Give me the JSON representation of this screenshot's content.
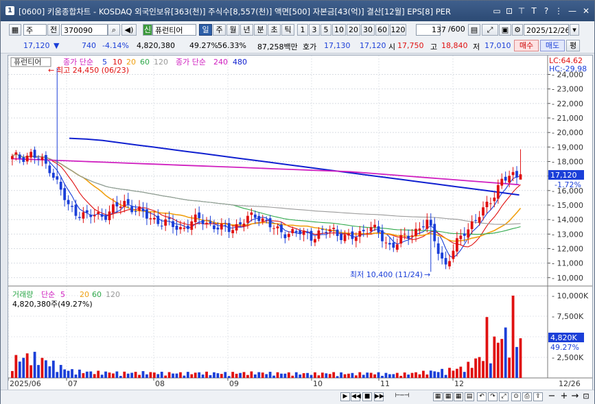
{
  "window": {
    "number": "1",
    "title": "[0600] 키움종합차트 - KOSDAQ 외국인보유[363(천)] 주식수[8,557(천)] 액면[500] 자본금[43(억)] 결산[12월] EPS[8] PER"
  },
  "toolbar": {
    "period_type": "주",
    "prev_label": "전",
    "code": "370090",
    "credit_badge": "신",
    "stock_name": "퓨런티어",
    "tabs": [
      "일",
      "주",
      "월",
      "년",
      "분",
      "초",
      "틱"
    ],
    "active_tab": "일",
    "intervals": [
      "1",
      "3",
      "5",
      "10",
      "20",
      "30",
      "60",
      "120"
    ],
    "count": "137",
    "count_total": "/600",
    "date": "2025/12/26"
  },
  "quote": {
    "price": "17,120",
    "change": "740",
    "change_pct": "-4.14%",
    "volume": "4,820,380",
    "vol_ratio1": "49.27%",
    "vol_ratio2": "56.33%",
    "amount": "87,258백만",
    "ask_label": "호가",
    "ask": "17,130",
    "bid": "17,120",
    "open_label": "시",
    "open": "17,750",
    "high_label": "고",
    "high": "18,840",
    "low_label": "저",
    "low": "17,010",
    "buy_btn": "매수",
    "sell_btn": "매도",
    "eval_btn": "평"
  },
  "price_panel": {
    "legend_name": "퓨런티어",
    "legend_ma_label": "종가 단순",
    "legend_ma_periods": [
      "5",
      "10",
      "20",
      "60",
      "120"
    ],
    "legend_ma2_label": "종가 단순",
    "legend_ma2_periods": [
      "240",
      "480"
    ],
    "lc_label": "LC:64.62",
    "hc_label": "HC:-29.98",
    "high_annotation": "최고 24,450 (06/23)",
    "low_annotation": "최저 10,400 (11/24)",
    "current_price_tag": "17,120",
    "current_change_tag": "-1.72%",
    "y_ticks": [
      "24,000",
      "23,000",
      "22,000",
      "21,000",
      "20,000",
      "19,000",
      "18,000",
      "17,000",
      "16,000",
      "15,000",
      "14,000",
      "13,000",
      "12,000",
      "11,000",
      "10,000"
    ],
    "colors": {
      "up": "#e01010",
      "down": "#1b3fd8",
      "ma5": "#1b3fd8",
      "ma10": "#e01010",
      "ma20": "#f0a010",
      "ma60": "#2ea84a",
      "ma120": "#9a9a9a",
      "ma240": "#d020c0",
      "ma480": "#1020d0"
    }
  },
  "volume_panel": {
    "legend_name": "거래량",
    "legend_ma_label": "단순",
    "legend_ma_periods": [
      "5",
      "20",
      "60",
      "120"
    ],
    "volume_text": "4,820,380주(49.27%)",
    "y_ticks": [
      "10,000K",
      "7,500K",
      "5,000K",
      "2,500K"
    ],
    "current_tag": "4,820K",
    "current_pct": "49.27%"
  },
  "x_axis": {
    "labels": [
      "2025/06",
      "07",
      "08",
      "09",
      "10",
      "11",
      "12"
    ],
    "right_label": "12/26"
  },
  "chart_data": {
    "type": "candlestick",
    "x": [
      "2025/06",
      "07",
      "08",
      "09",
      "10",
      "11",
      "12"
    ],
    "ylim": [
      10000,
      24450
    ],
    "series": [
      {
        "name": "퓨런티어",
        "type": "close",
        "values": [
          18200,
          18500,
          17600,
          14800,
          14200,
          14400,
          15200,
          14300,
          13800,
          13400,
          14100,
          13300,
          13600,
          14400,
          13200,
          13100,
          12900,
          13300,
          12600,
          13600,
          12200,
          12800,
          13900,
          10800,
          13200,
          14500,
          16700,
          17120
        ]
      },
      {
        "name": "480",
        "values": [
          19600,
          19550,
          19450,
          19300,
          19150,
          19000,
          18850,
          18700,
          18550,
          18400,
          18250,
          18100,
          17950,
          17800,
          17650,
          17500,
          17350,
          17200,
          17050,
          16900,
          16750,
          16600,
          16450,
          16300,
          16150,
          16000,
          15850,
          15700
        ]
      },
      {
        "name": "240",
        "values": [
          18200,
          18150,
          18100,
          18050,
          18000,
          17950,
          17900,
          17850,
          17800,
          17750,
          17700,
          17650,
          17600,
          17550,
          17500,
          17450,
          17400,
          17350,
          17300,
          17200,
          17100,
          17000,
          16900,
          16800,
          16700,
          16600,
          16500,
          16400
        ]
      }
    ],
    "volume": [
      2100,
      2600,
      1800,
      900,
      700,
      650,
      600,
      640,
      580,
      560,
      600,
      560,
      590,
      620,
      560,
      540,
      520,
      560,
      500,
      580,
      480,
      520,
      700,
      900,
      1200,
      2600,
      5000,
      4820
    ]
  },
  "bottom": {
    "controls": [
      "▶",
      "◀◀",
      "◀",
      "■",
      "▶▶"
    ]
  }
}
